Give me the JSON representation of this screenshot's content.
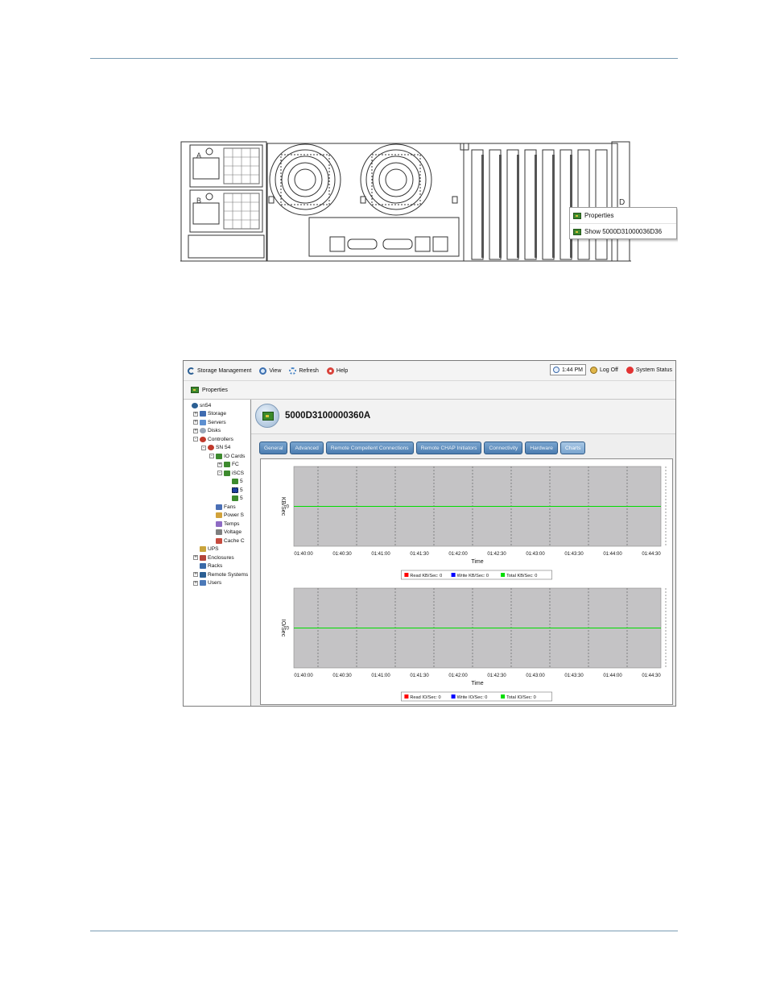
{
  "hardware_view": {
    "slot_labels": [
      "A",
      "B"
    ],
    "context_menu": {
      "items": [
        {
          "label": "Properties",
          "icon": "io-card-icon"
        },
        {
          "label": "Show 5000D31000036D36",
          "icon": "io-card-icon"
        }
      ]
    }
  },
  "app": {
    "menubar": {
      "items": [
        {
          "label": "Storage Management",
          "icon": "compellent-logo-icon"
        },
        {
          "label": "View",
          "icon": "magnifier-icon"
        },
        {
          "label": "Refresh",
          "icon": "refresh-icon"
        },
        {
          "label": "Help",
          "icon": "lifebuoy-icon"
        }
      ],
      "time": "1:44 PM",
      "logoff": "Log Off",
      "system_status": "System Status",
      "status_color": "#e23333"
    },
    "toolbar": {
      "properties": "Properties"
    },
    "tree": [
      {
        "label": "sn54",
        "level": 0,
        "expander": "",
        "icon": "compellent-logo-icon"
      },
      {
        "label": "Storage",
        "level": 1,
        "expander": "+",
        "icon": "storage-icon"
      },
      {
        "label": "Servers",
        "level": 1,
        "expander": "+",
        "icon": "servers-icon"
      },
      {
        "label": "Disks",
        "level": 1,
        "expander": "+",
        "icon": "disks-icon"
      },
      {
        "label": "Controllers",
        "level": 1,
        "expander": "-",
        "icon": "controllers-icon"
      },
      {
        "label": "SN 54",
        "level": 2,
        "expander": "-",
        "icon": "controller-icon"
      },
      {
        "label": "IO Cards",
        "level": 3,
        "expander": "-",
        "icon": "io-card-icon"
      },
      {
        "label": "FC",
        "level": 4,
        "expander": "+",
        "icon": "io-card-icon"
      },
      {
        "label": "iSCS",
        "level": 4,
        "expander": "-",
        "icon": "io-card-icon"
      },
      {
        "label": "5",
        "level": 5,
        "expander": "",
        "icon": "io-card-icon"
      },
      {
        "label": "5",
        "level": 5,
        "expander": "",
        "icon": "io-card-icon",
        "selected": true
      },
      {
        "label": "5",
        "level": 5,
        "expander": "",
        "icon": "io-card-icon"
      },
      {
        "label": "Fans",
        "level": 3,
        "expander": "",
        "icon": "fans-icon"
      },
      {
        "label": "Power S",
        "level": 3,
        "expander": "",
        "icon": "power-supply-icon"
      },
      {
        "label": "Temps",
        "level": 3,
        "expander": "",
        "icon": "thermometer-icon"
      },
      {
        "label": "Voltage",
        "level": 3,
        "expander": "",
        "icon": "voltage-icon"
      },
      {
        "label": "Cache C",
        "level": 3,
        "expander": "",
        "icon": "cache-icon"
      },
      {
        "label": "UPS",
        "level": 1,
        "expander": "",
        "icon": "ups-icon"
      },
      {
        "label": "Enclosures",
        "level": 1,
        "expander": "+",
        "icon": "enclosures-icon"
      },
      {
        "label": "Racks",
        "level": 1,
        "expander": "",
        "icon": "racks-icon"
      },
      {
        "label": "Remote Systems",
        "level": 1,
        "expander": "+",
        "icon": "remote-systems-icon"
      },
      {
        "label": "Users",
        "level": 1,
        "expander": "+",
        "icon": "users-icon"
      }
    ],
    "panel": {
      "title": "5000D3100000360A",
      "tabs": [
        {
          "label": "General",
          "active": false
        },
        {
          "label": "Advanced",
          "active": false
        },
        {
          "label": "Remote Compellent Connections",
          "active": false
        },
        {
          "label": "Remote CHAP Initiators",
          "active": false
        },
        {
          "label": "Connectivity",
          "active": false
        },
        {
          "label": "Hardware",
          "active": false
        },
        {
          "label": "Charts",
          "active": true
        }
      ]
    }
  },
  "chart_data": [
    {
      "type": "line",
      "ylabel": "KB/Sec",
      "xlabel": "Time",
      "x": [
        "01:40:00",
        "01:40:30",
        "01:41:00",
        "01:41:30",
        "01:42:00",
        "01:42:30",
        "01:43:00",
        "01:43:30",
        "01:44:00",
        "01:44:30"
      ],
      "y_ticks": [
        "0"
      ],
      "series": [
        {
          "name": "Read KB/Sec: 0",
          "color": "#ff0000",
          "values": []
        },
        {
          "name": "Write KB/Sec: 0",
          "color": "#0000ff",
          "values": []
        },
        {
          "name": "Total KB/Sec: 0",
          "color": "#00dd00",
          "values": [
            0,
            0,
            0,
            0,
            0,
            0,
            0,
            0,
            0,
            0
          ]
        }
      ],
      "grid": true,
      "legend": "bottom",
      "plot_background": "#c4c3c5"
    },
    {
      "type": "line",
      "ylabel": "IO/Sec",
      "xlabel": "Time",
      "x": [
        "01:40:00",
        "01:40:30",
        "01:41:00",
        "01:41:30",
        "01:42:00",
        "01:42:30",
        "01:43:00",
        "01:43:30",
        "01:44:00",
        "01:44:30"
      ],
      "y_ticks": [
        "0"
      ],
      "series": [
        {
          "name": "Read IO/Sec: 0",
          "color": "#ff0000",
          "values": []
        },
        {
          "name": "Write IO/Sec: 0",
          "color": "#0000ff",
          "values": []
        },
        {
          "name": "Total IO/Sec: 0",
          "color": "#00dd00",
          "values": [
            0,
            0,
            0,
            0,
            0,
            0,
            0,
            0,
            0,
            0
          ]
        }
      ],
      "grid": true,
      "legend": "bottom",
      "plot_background": "#c4c3c5"
    }
  ]
}
